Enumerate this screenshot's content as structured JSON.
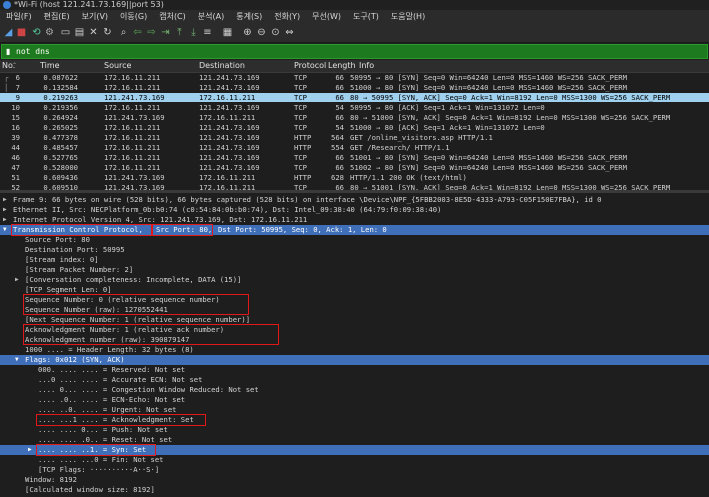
{
  "window": {
    "title": "*Wi-Fi (host 121.241.73.169||port 53)"
  },
  "menu": [
    "파일(F)",
    "편집(E)",
    "보기(V)",
    "이동(G)",
    "캡처(C)",
    "분석(A)",
    "통계(S)",
    "전화(Y)",
    "무선(W)",
    "도구(T)",
    "도움말(H)"
  ],
  "toolbar": {
    "icons": [
      "shark-start-icon",
      "stop-icon",
      "restart-icon",
      "options-icon",
      "open-icon",
      "save-icon",
      "close-file-icon",
      "reload-icon",
      "find-icon",
      "back-icon",
      "forward-icon",
      "goto-icon",
      "first-icon",
      "last-icon",
      "autoscroll-icon",
      "colorize-icon",
      "zoom-in-icon",
      "zoom-out-icon",
      "zoom-reset-icon",
      "resize-columns-icon"
    ]
  },
  "filter": {
    "text": "not dns"
  },
  "columns": [
    "No.",
    "Time",
    "Source",
    "Destination",
    "Protocol",
    "Length",
    "Info"
  ],
  "packets": [
    {
      "no": "6",
      "time": "0.087622",
      "src": "172.16.11.211",
      "dst": "121.241.73.169",
      "proto": "TCP",
      "len": "66",
      "info": "50995 → 80 [SYN] Seq=0 Win=64240 Len=0 MSS=1460 WS=256 SACK_PERM"
    },
    {
      "no": "7",
      "time": "0.132584",
      "src": "172.16.11.211",
      "dst": "121.241.73.169",
      "proto": "TCP",
      "len": "66",
      "info": "51000 → 80 [SYN] Seq=0 Win=64240 Len=0 MSS=1460 WS=256 SACK_PERM"
    },
    {
      "no": "9",
      "time": "0.219263",
      "src": "121.241.73.169",
      "dst": "172.16.11.211",
      "proto": "TCP",
      "len": "66",
      "info": "80 → 50995 [SYN, ACK] Seq=0 Ack=1 Win=8192 Len=0 MSS=1300 WS=256 SACK_PERM"
    },
    {
      "no": "10",
      "time": "0.219356",
      "src": "172.16.11.211",
      "dst": "121.241.73.169",
      "proto": "TCP",
      "len": "54",
      "info": "50995 → 80 [ACK] Seq=1 Ack=1 Win=131072 Len=0"
    },
    {
      "no": "15",
      "time": "0.264924",
      "src": "121.241.73.169",
      "dst": "172.16.11.211",
      "proto": "TCP",
      "len": "66",
      "info": "80 → 51000 [SYN, ACK] Seq=0 Ack=1 Win=8192 Len=0 MSS=1300 WS=256 SACK_PERM"
    },
    {
      "no": "16",
      "time": "0.265025",
      "src": "172.16.11.211",
      "dst": "121.241.73.169",
      "proto": "TCP",
      "len": "54",
      "info": "51000 → 80 [ACK] Seq=1 Ack=1 Win=131072 Len=0"
    },
    {
      "no": "39",
      "time": "0.477378",
      "src": "172.16.11.211",
      "dst": "121.241.73.169",
      "proto": "HTTP",
      "len": "564",
      "info": "GET /online_visitors.asp HTTP/1.1"
    },
    {
      "no": "44",
      "time": "0.485457",
      "src": "172.16.11.211",
      "dst": "121.241.73.169",
      "proto": "HTTP",
      "len": "554",
      "info": "GET /Research/ HTTP/1.1"
    },
    {
      "no": "46",
      "time": "0.527765",
      "src": "172.16.11.211",
      "dst": "121.241.73.169",
      "proto": "TCP",
      "len": "66",
      "info": "51001 → 80 [SYN] Seq=0 Win=64240 Len=0 MSS=1460 WS=256 SACK_PERM"
    },
    {
      "no": "47",
      "time": "0.528000",
      "src": "172.16.11.211",
      "dst": "121.241.73.169",
      "proto": "TCP",
      "len": "66",
      "info": "51002 → 80 [SYN] Seq=0 Win=64240 Len=0 MSS=1460 WS=256 SACK_PERM"
    },
    {
      "no": "51",
      "time": "0.609436",
      "src": "121.241.73.169",
      "dst": "172.16.11.211",
      "proto": "HTTP",
      "len": "628",
      "info": "HTTP/1.1 200 OK  (text/html)"
    },
    {
      "no": "52",
      "time": "0.609510",
      "src": "121.241.73.169",
      "dst": "172.16.11.211",
      "proto": "TCP",
      "len": "66",
      "info": "80 → 51001 [SYN, ACK] Seq=0 Ack=1 Win=8192 Len=0 MSS=1300 WS=256 SACK_PERM"
    }
  ],
  "selected_row_index": 2,
  "details": {
    "frame": "Frame 9: 66 bytes on wire (528 bits), 66 bytes captured (528 bits) on interface \\Device\\NPF_{5FBB2003-8E5D-4333-A793-C05F150E7FBA}, id 0",
    "ethernet": "Ethernet II, Src: NECPlatform_0b:b0:74 (c0:54:84:0b:b0:74), Dst: Intel_09:38:40 (64:79:f0:09:38:40)",
    "ip": "Internet Protocol Version 4, Src: 121.241.73.169, Dst: 172.16.11.211",
    "tcp_title": "Transmission Control Protocol,",
    "tcp_src": "Src Port: 80,",
    "tcp_rest": "Dst Port: 50995, Seq: 0, Ack: 1, Len: 0",
    "lines": [
      "Source Port: 80",
      "Destination Port: 50995",
      "[Stream index: 0]",
      "[Stream Packet Number: 2]",
      "[Conversation completeness: Incomplete, DATA (15)]",
      "[TCP Segment Len: 0]",
      "Sequence Number: 0    (relative sequence number)",
      "Sequence Number (raw): 1270552441",
      "[Next Sequence Number: 1    (relative sequence number)]",
      "Acknowledgment Number: 1    (relative ack number)",
      "Acknowledgment number (raw): 390879147",
      "1000 .... = Header Length: 32 bytes (8)"
    ],
    "flags_title": "Flags: 0x012 (SYN, ACK)",
    "flag_lines": [
      "000. .... .... = Reserved: Not set",
      "...0 .... .... = Accurate ECN: Not set",
      ".... 0... .... = Congestion Window Reduced: Not set",
      ".... .0.. .... = ECN-Echo: Not set",
      ".... ..0. .... = Urgent: Not set",
      ".... ...1 .... = Acknowledgment: Set",
      ".... .... 0... = Push: Not set",
      ".... .... .0.. = Reset: Not set",
      ".... .... ..1. = Syn: Set",
      ".... .... ...0 = Fin: Not set",
      "[TCP Flags: ··········A··S·]"
    ],
    "window": "Window: 8192",
    "calc_window": "[Calculated window size: 8192]"
  }
}
